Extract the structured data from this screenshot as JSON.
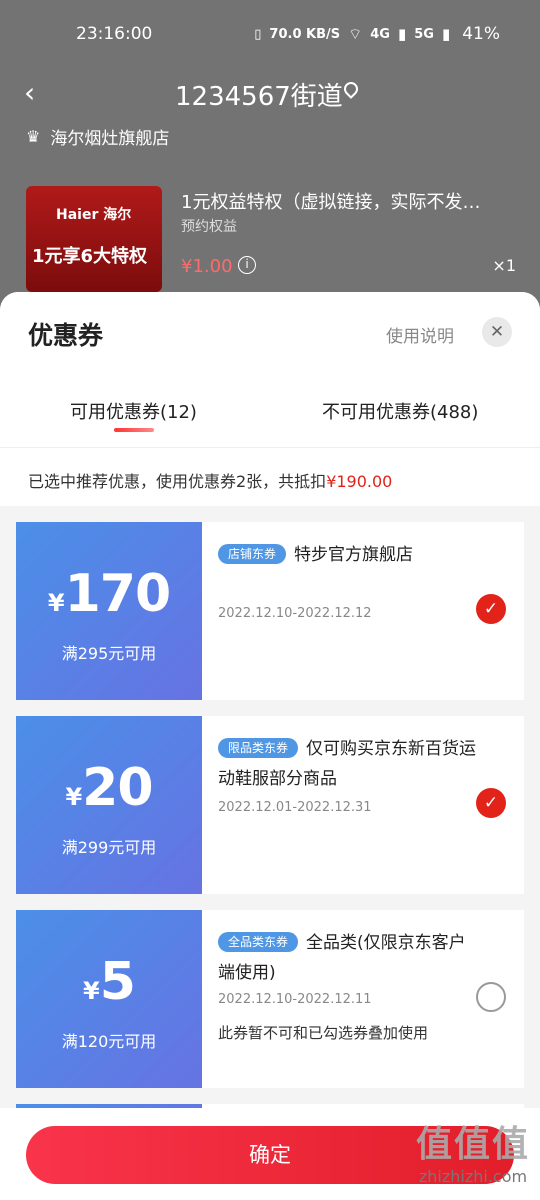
{
  "status_bar": {
    "time": "23:16:00",
    "net_speed": "70.0 KB/S",
    "wifi_icon": "wifi-icon",
    "signal1": "4G",
    "signal2": "5G",
    "battery": "41%"
  },
  "header": {
    "address": "1234567街道",
    "shop_name": "海尔烟灶旗舰店"
  },
  "product": {
    "image_brand": "Haier 海尔",
    "image_promo": "1元享6大特权",
    "title": "1元权益特权（虚拟链接，实际不发…",
    "subtitle": "预约权益",
    "price": "¥1.00",
    "quantity": "×1"
  },
  "sheet": {
    "title": "优惠券",
    "help_link": "使用说明",
    "tabs": [
      {
        "label": "可用优惠券(12)",
        "active": true
      },
      {
        "label": "不可用优惠券(488)",
        "active": false
      }
    ],
    "summary_prefix": "已选中推荐优惠，使用优惠券2张，共抵扣",
    "summary_amount": "¥190.00"
  },
  "coupons": [
    {
      "symbol": "¥",
      "amount": "170",
      "condition": "满295元可用",
      "tag": "店铺东券",
      "name": "特步官方旗舰店",
      "date": "2022.12.10-2022.12.12",
      "note": "",
      "checked": true
    },
    {
      "symbol": "¥",
      "amount": "20",
      "condition": "满299元可用",
      "tag": "限品类东券",
      "name": "仅可购买京东新百货运动鞋服部分商品",
      "date": "2022.12.01-2022.12.31",
      "note": "",
      "checked": true
    },
    {
      "symbol": "¥",
      "amount": "5",
      "condition": "满120元可用",
      "tag": "全品类东券",
      "name": "全品类(仅限京东客户端使用)",
      "date": "2022.12.10-2022.12.11",
      "note": "此券暂不可和已勾选券叠加使用",
      "checked": false
    }
  ],
  "confirm": {
    "label": "确定"
  },
  "watermark": {
    "logo": "值值值",
    "site": "zhizhizhi.com"
  },
  "colors": {
    "accent_red": "#e2231a",
    "coupon_blue": "#4b8fe8",
    "tag_blue": "#4f97e4"
  }
}
